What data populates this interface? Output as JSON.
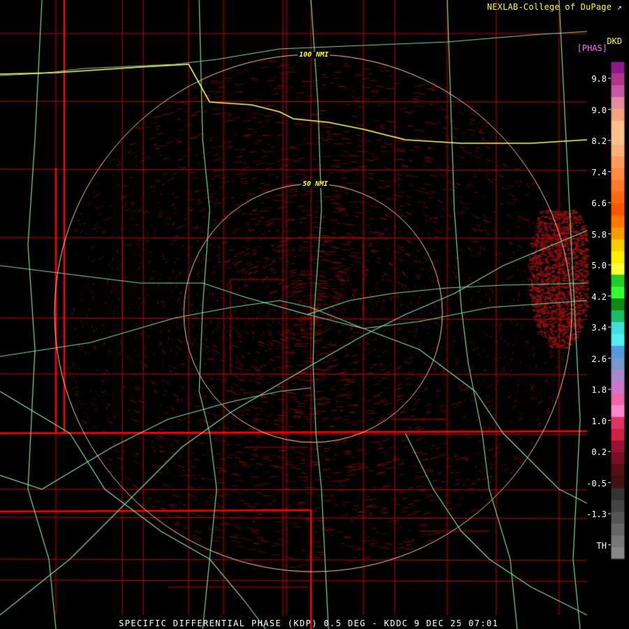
{
  "header": {
    "credit": "NEXLAB-College of DuPage",
    "credit_icon": "external-link-icon",
    "station_code": "DKD",
    "unit": "[PHAS]"
  },
  "footer": {
    "product_line": "SPECIFIC DIFFERENTIAL PHASE (KDP) 0.5 DEG - KDDC 9 DEC 25 07:01"
  },
  "range_rings": [
    {
      "label": "100 NMI"
    },
    {
      "label": "50 NMI"
    }
  ],
  "legend": {
    "labels": [
      "9.8",
      "9.0",
      "8.2",
      "7.4",
      "6.6",
      "5.8",
      "5.0",
      "4.2",
      "3.4",
      "2.6",
      "1.8",
      "1.0",
      "0.2",
      "-0.5",
      "-1.3",
      "TH"
    ],
    "colors_top_to_bottom": [
      "#8a1a8a",
      "#b0368a",
      "#c55aa0",
      "#e58ca3",
      "#f3a37a",
      "#ffbf8a",
      "#ffc090",
      "#ffb07a",
      "#ff9a5a",
      "#ff8a40",
      "#ff7a25",
      "#ff6a10",
      "#ff5500",
      "#ff7700",
      "#ff9900",
      "#ffcc00",
      "#ffee00",
      "#ffff33",
      "#22cc22",
      "#33ff33",
      "#118811",
      "#1bbb66",
      "#44dddd",
      "#55eeee",
      "#5599dd",
      "#7799cc",
      "#aa88cc",
      "#cc77cc",
      "#ee66aa",
      "#ff88cc",
      "#dd3366",
      "#cc2244",
      "#991133",
      "#771122",
      "#551111",
      "#441111",
      "#333333",
      "#444444",
      "#555555",
      "#666666",
      "#777777",
      "#888888"
    ]
  },
  "colors": {
    "background": "#000000",
    "county_lines": "#c80000",
    "state_lines": "#ff0000",
    "highways": "#7fdc9c",
    "interstate": "#ffff66",
    "range_rings": "#ffcc99",
    "kdp_returns": "#7a0a0a"
  }
}
